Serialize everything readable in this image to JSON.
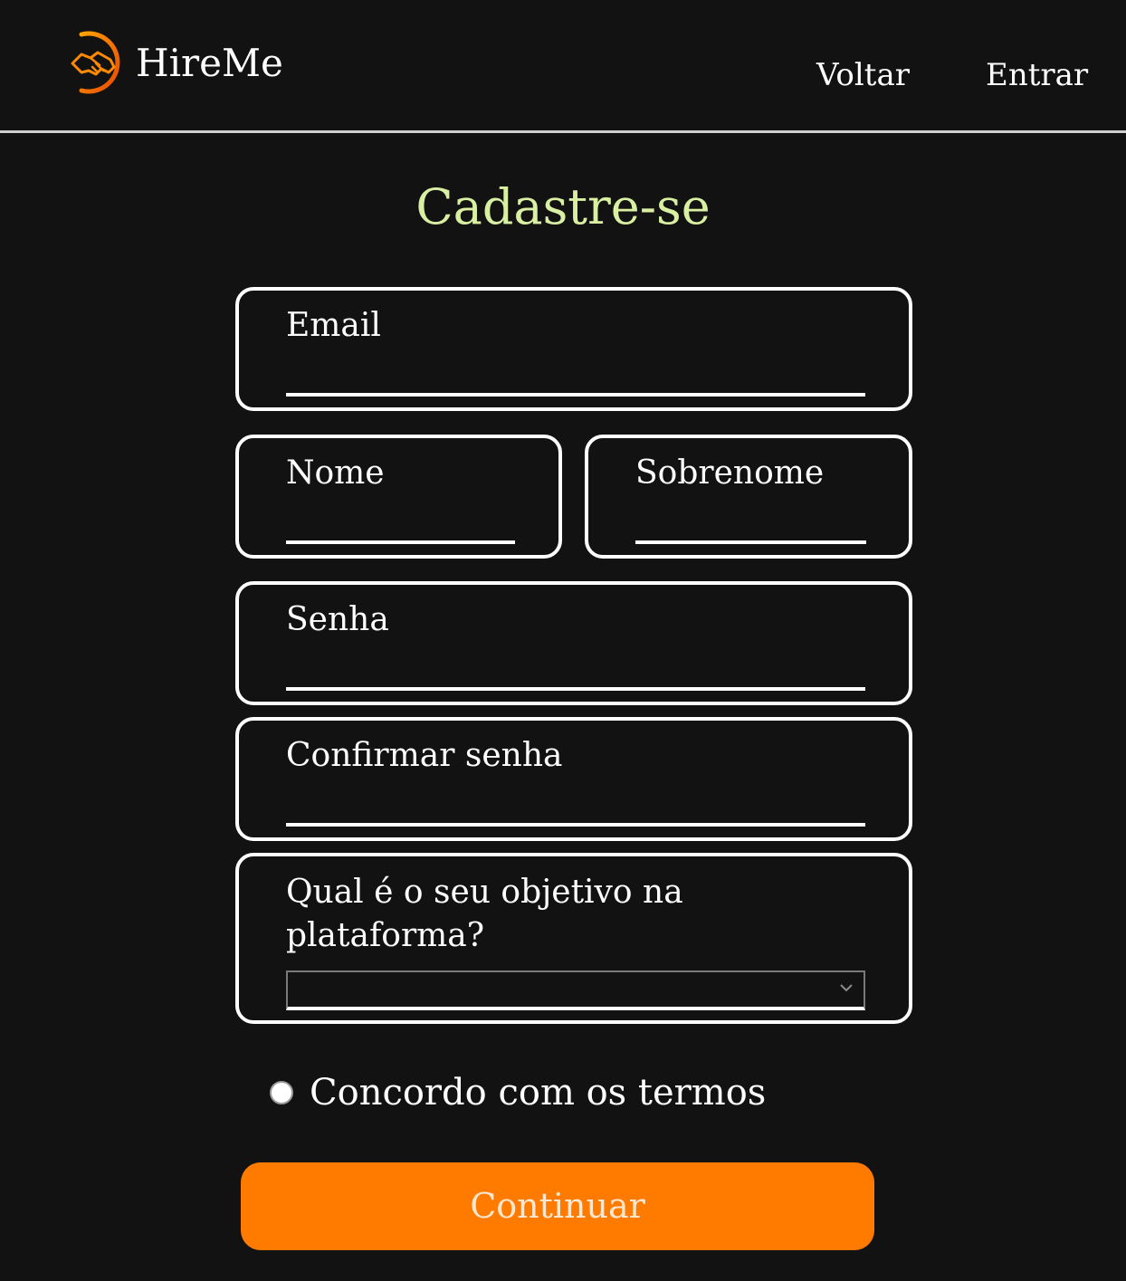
{
  "header": {
    "brand": "HireMe",
    "logo_icon": "handshake-icon",
    "nav": {
      "back": "Voltar",
      "login": "Entrar"
    }
  },
  "form": {
    "title": "Cadastre-se",
    "fields": {
      "email": {
        "label": "Email",
        "value": ""
      },
      "first_name": {
        "label": "Nome",
        "value": ""
      },
      "last_name": {
        "label": "Sobrenome",
        "value": ""
      },
      "password": {
        "label": "Senha",
        "value": ""
      },
      "confirm_password": {
        "label": "Confirmar senha",
        "value": ""
      },
      "goal": {
        "label": "Qual é o seu objetivo na plataforma?",
        "selected": ""
      }
    },
    "terms_label": "Concordo com os termos",
    "submit_label": "Continuar"
  },
  "colors": {
    "background": "#121212",
    "title": "#d9efa2",
    "accent": "#ff7b00",
    "logo_gradient_start": "#ffa000",
    "logo_gradient_end": "#e84a00"
  }
}
